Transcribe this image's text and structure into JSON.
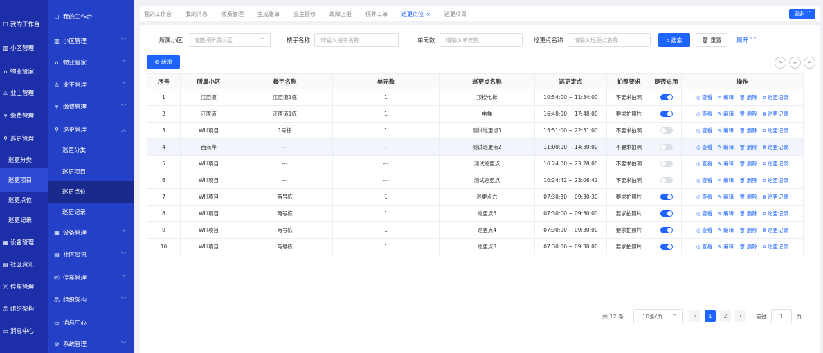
{
  "sidebar1": [
    {
      "icon": "☐",
      "label": "我的工作台"
    },
    {
      "icon": "▥",
      "label": "小区管理"
    },
    {
      "icon": "⌂",
      "label": "物业管家"
    },
    {
      "icon": "♙",
      "label": "业主管理"
    },
    {
      "icon": "¥",
      "label": "缴费管理"
    },
    {
      "icon": "⚲",
      "label": "巡更管理"
    },
    {
      "label": "巡更分类"
    },
    {
      "label": "巡更项目"
    },
    {
      "label": "巡更点位"
    },
    {
      "label": "巡更记录"
    },
    {
      "icon": "▦",
      "label": "设备管理"
    },
    {
      "icon": "▤",
      "label": "社区资讯"
    },
    {
      "icon": "Ⓟ",
      "label": "停车管理"
    },
    {
      "icon": "品",
      "label": "组织架构"
    },
    {
      "icon": "▭",
      "label": "消息中心"
    }
  ],
  "sidebar2": [
    {
      "icon": "☐",
      "label": "我的工作台"
    },
    {
      "icon": "▥",
      "label": "小区管理",
      "chev": "﹀"
    },
    {
      "icon": "⌂",
      "label": "物业管家",
      "chev": "﹀"
    },
    {
      "icon": "♙",
      "label": "业主管理",
      "chev": "﹀"
    },
    {
      "icon": "¥",
      "label": "缴费管理",
      "chev": "﹀"
    },
    {
      "icon": "⚲",
      "label": "巡更管理",
      "chev": "︿"
    },
    {
      "label": "巡更分类"
    },
    {
      "label": "巡更项目"
    },
    {
      "label": "巡更点位"
    },
    {
      "label": "巡更记录"
    },
    {
      "icon": "▦",
      "label": "设备管理",
      "chev": "﹀"
    },
    {
      "icon": "▤",
      "label": "社区资讯",
      "chev": "﹀"
    },
    {
      "icon": "Ⓟ",
      "label": "停车管理",
      "chev": "﹀"
    },
    {
      "icon": "品",
      "label": "组织架构",
      "chev": "﹀"
    },
    {
      "icon": "▭",
      "label": "消息中心"
    },
    {
      "icon": "⚙",
      "label": "系统管理",
      "chev": "﹀"
    }
  ],
  "tabs": [
    "我的工作台",
    "我的消息",
    "收费管理",
    "生成账单",
    "业主报修",
    "故障上报",
    "保养工单",
    "巡更点位",
    "巡更项目"
  ],
  "tab_close": "×",
  "more_label": "更多 ﹀",
  "filter": {
    "community_label": "所属小区",
    "community_placeholder": "请选择所属小区",
    "building_label": "楼宇名称",
    "building_placeholder": "请输入楼宇名称",
    "unit_label": "单元数",
    "unit_placeholder": "请输入单元数",
    "point_label": "巡更点名称",
    "point_placeholder": "请输入巡更点名称",
    "search_label": "⌕ 搜索",
    "reset_label": "🗑 重置",
    "expand_label": "展开 ﹀",
    "arrow": "﹀"
  },
  "add_label": "⊕ 新增",
  "tools": [
    "⟳",
    "≡",
    "⌕"
  ],
  "table": {
    "headers": [
      "序号",
      "所属小区",
      "楼宇名称",
      "单元数",
      "巡更点名称",
      "巡更定点",
      "拍照要求",
      "是否启用",
      "操作"
    ],
    "ops": [
      {
        "icon": "◎",
        "label": "查看"
      },
      {
        "icon": "✎",
        "label": "编辑"
      },
      {
        "icon": "🗑",
        "label": "删除"
      },
      {
        "icon": "⧉",
        "label": "巡更记录"
      }
    ],
    "rows": [
      {
        "no": "1",
        "community": "江原道",
        "building": "江原道1栋",
        "unit": "1",
        "name": "顶楼电梯",
        "time": "10:54:00 ~ 11:54:00",
        "photo": "不要求拍照",
        "enabled": true
      },
      {
        "no": "2",
        "community": "江原道",
        "building": "江原道1栋",
        "unit": "1",
        "name": "电梯",
        "time": "16:48:00 ~ 17:48:00",
        "photo": "要求拍照片",
        "enabled": true
      },
      {
        "no": "3",
        "community": "WIII项目",
        "building": "1号栋",
        "unit": "1",
        "name": "测试巡更点3",
        "time": "15:51:00 ~ 22:51:00",
        "photo": "不要求拍照",
        "enabled": false
      },
      {
        "no": "4",
        "community": "西海岸",
        "building": "---",
        "unit": "---",
        "name": "测试巡更点2",
        "time": "11:00:00 ~ 14:30:00",
        "photo": "不要求拍照",
        "enabled": false
      },
      {
        "no": "5",
        "community": "WIII项目",
        "building": "---",
        "unit": "---",
        "name": "测试巡更点",
        "time": "10:24:00 ~ 23:28:00",
        "photo": "不要求拍照",
        "enabled": false
      },
      {
        "no": "6",
        "community": "WIII项目",
        "building": "---",
        "unit": "---",
        "name": "测试巡更点",
        "time": "10:24:42 ~ 23:06:42",
        "photo": "不要求拍照",
        "enabled": false
      },
      {
        "no": "7",
        "community": "WIII项目",
        "building": "两号栋",
        "unit": "1",
        "name": "巡更点六",
        "time": "07:30:30 ~ 09:30:30",
        "photo": "要求拍照片",
        "enabled": true
      },
      {
        "no": "8",
        "community": "WIII项目",
        "building": "两号栋",
        "unit": "1",
        "name": "巡更点5",
        "time": "07:30:00 ~ 09:30:00",
        "photo": "要求拍照片",
        "enabled": true
      },
      {
        "no": "9",
        "community": "WIII项目",
        "building": "两号栋",
        "unit": "1",
        "name": "巡更点4",
        "time": "07:30:00 ~ 09:30:00",
        "photo": "要求拍照片",
        "enabled": true
      },
      {
        "no": "10",
        "community": "WIII项目",
        "building": "两号栋",
        "unit": "1",
        "name": "巡更点3",
        "time": "07:30:00 ~ 09:30:00",
        "photo": "要求拍照片",
        "enabled": true
      }
    ]
  },
  "pagination": {
    "total": "共 12 条",
    "page_size": "10条/页",
    "size_arrow": "﹀",
    "prev": "‹",
    "pages": [
      "1",
      "2"
    ],
    "next": "›",
    "goto_label": "前往",
    "goto_value": "1",
    "unit": "页"
  },
  "colors": {
    "primary": "#1e64ff",
    "sidebar_dark": "#1d2fa8",
    "sidebar": "#2440c7"
  }
}
